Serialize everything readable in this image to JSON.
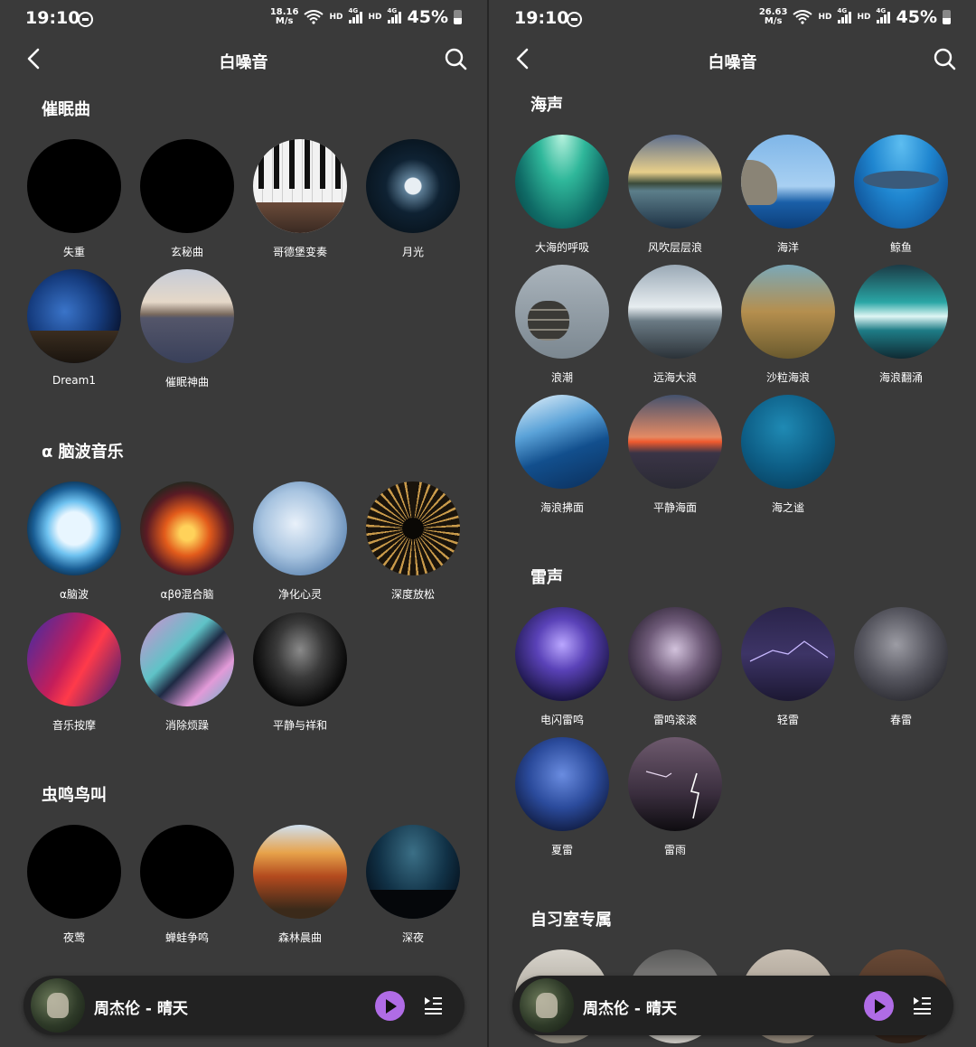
{
  "status_bar": {
    "time": "19:10",
    "battery": "45%",
    "battery_level": 0.45,
    "hd": "HD",
    "net": "4G"
  },
  "left": {
    "speed": {
      "value": "18.16",
      "unit": "M/s"
    },
    "title": "白噪音",
    "sections": [
      {
        "title": "催眠曲",
        "items": [
          "失重",
          "玄秘曲",
          "哥德堡变奏",
          "月光",
          "Dream1",
          "催眠神曲"
        ]
      },
      {
        "title": "α 脑波音乐",
        "items": [
          "α脑波",
          "αβθ混合脑",
          "净化心灵",
          "深度放松",
          "音乐按摩",
          "消除烦躁",
          "平静与祥和"
        ]
      },
      {
        "title": "虫鸣鸟叫",
        "items": [
          "夜莺",
          "蝉蛙争鸣",
          "森林晨曲",
          "深夜"
        ]
      }
    ]
  },
  "right": {
    "speed": {
      "value": "26.63",
      "unit": "M/s"
    },
    "title": "白噪音",
    "sections": [
      {
        "title": "海声",
        "items": [
          "大海的呼吸",
          "风吹层层浪",
          "海洋",
          "鲸鱼",
          "浪潮",
          "远海大浪",
          "沙粒海浪",
          "海浪翻涌",
          "海浪拂面",
          "平静海面",
          "海之谧"
        ]
      },
      {
        "title": "雷声",
        "items": [
          "电闪雷鸣",
          "雷鸣滚滚",
          "轻雷",
          "春雷",
          "夏雷",
          "雷雨"
        ]
      },
      {
        "title": "自习室专属",
        "items": []
      }
    ]
  },
  "player": {
    "song": "周杰伦 - 晴天"
  },
  "icons": {
    "back": "chevron-left-icon",
    "search": "search-icon",
    "play": "play-icon",
    "playlist": "playlist-icon",
    "dnd": "do-not-disturb-icon",
    "wifi": "wifi-icon",
    "signal": "signal-icon",
    "battery": "battery-icon"
  },
  "colors": {
    "background": "#3a3a3a",
    "accent": "#b06ce6",
    "player_bg": "#222222"
  }
}
